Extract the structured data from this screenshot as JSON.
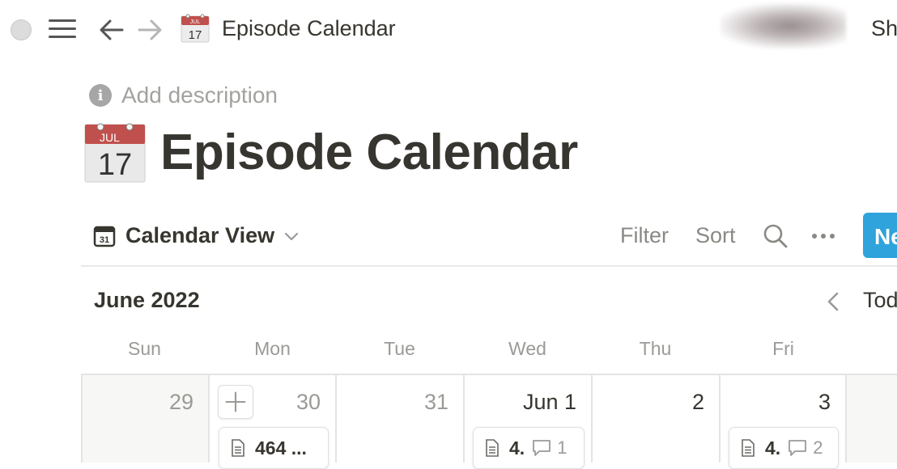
{
  "topbar": {
    "breadcrumb_title": "Episode Calendar",
    "share_label": "Sh"
  },
  "page": {
    "description_placeholder": "Add description",
    "title": "Episode Calendar",
    "icon": "calendar-jul-17-icon",
    "icon_month": "JUL",
    "icon_day": "17"
  },
  "view": {
    "name": "Calendar View",
    "icon_day": "31",
    "filter_label": "Filter",
    "sort_label": "Sort",
    "new_label": "Ne"
  },
  "calendar": {
    "month_label": "June 2022",
    "today_label": "Tod",
    "weekdays": [
      "Sun",
      "Mon",
      "Tue",
      "Wed",
      "Thu",
      "Fri"
    ],
    "days": [
      {
        "label": "29"
      },
      {
        "label": "30"
      },
      {
        "label": "31"
      },
      {
        "label": "Jun 1"
      },
      {
        "label": "2"
      },
      {
        "label": "3"
      }
    ],
    "cards": [
      {
        "title": "464 ...",
        "comments": ""
      },
      {
        "title": "4.",
        "comments": "1"
      },
      {
        "title": "4.",
        "comments": "2"
      }
    ]
  },
  "colors": {
    "accent": "#2ea3dc",
    "text": "#37352f",
    "muted": "#9b9a97",
    "calendar_red": "#c0504d"
  }
}
